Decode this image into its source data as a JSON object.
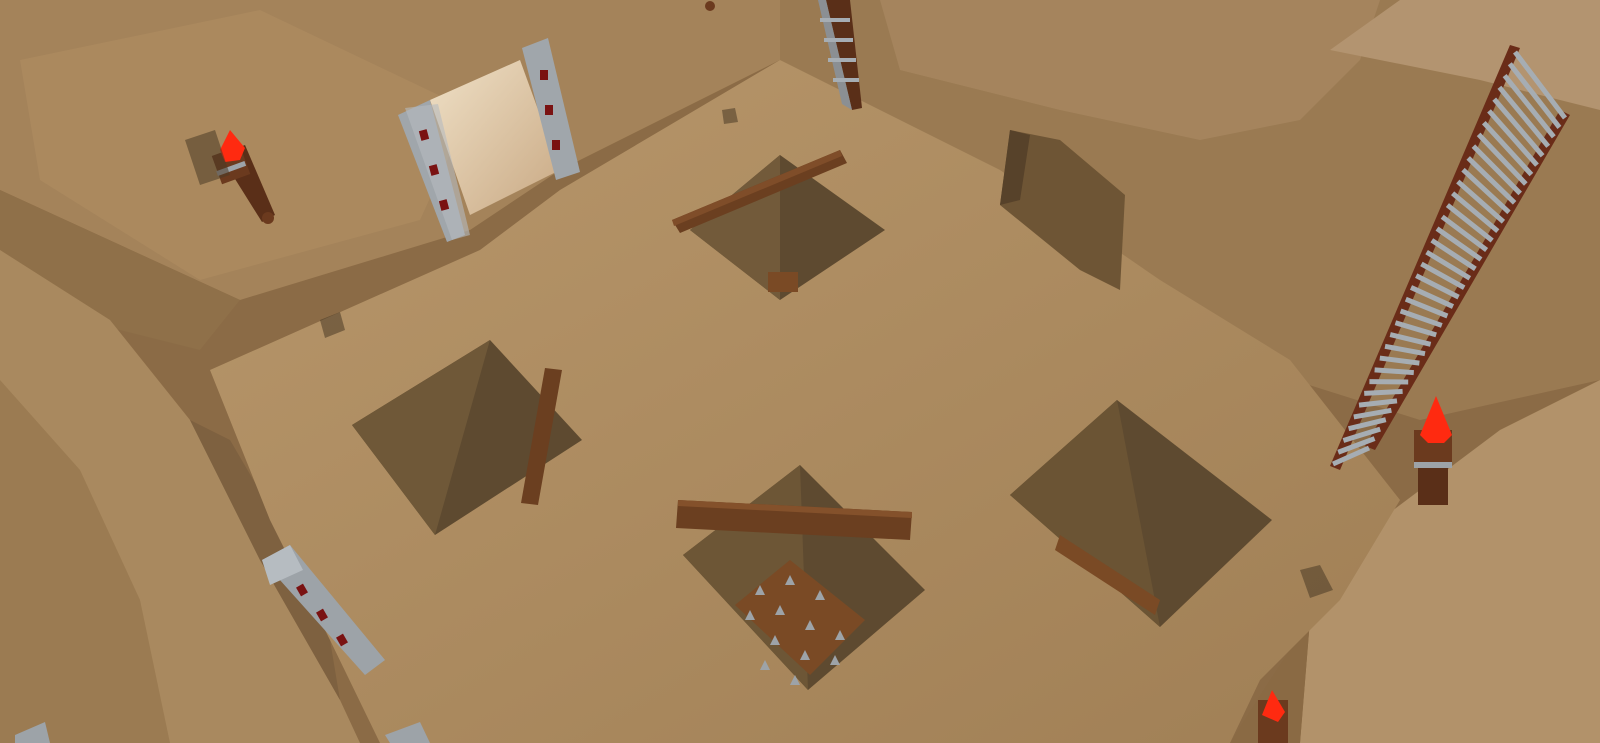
{
  "viewport": {
    "left_handle": "◇",
    "right_handle": "◇"
  },
  "scene": {
    "description_colors": {
      "floor": "#a8875e",
      "wall_light": "#b79a72",
      "wall_dark": "#7a5e3d",
      "pit_shadow": "#5e4a30",
      "plank": "#6b3f20",
      "stone": "#9da3a8",
      "fire": "#ff2a10",
      "spike_bed": "#7a4a25",
      "ladder_rung": "#a6adb3"
    }
  }
}
